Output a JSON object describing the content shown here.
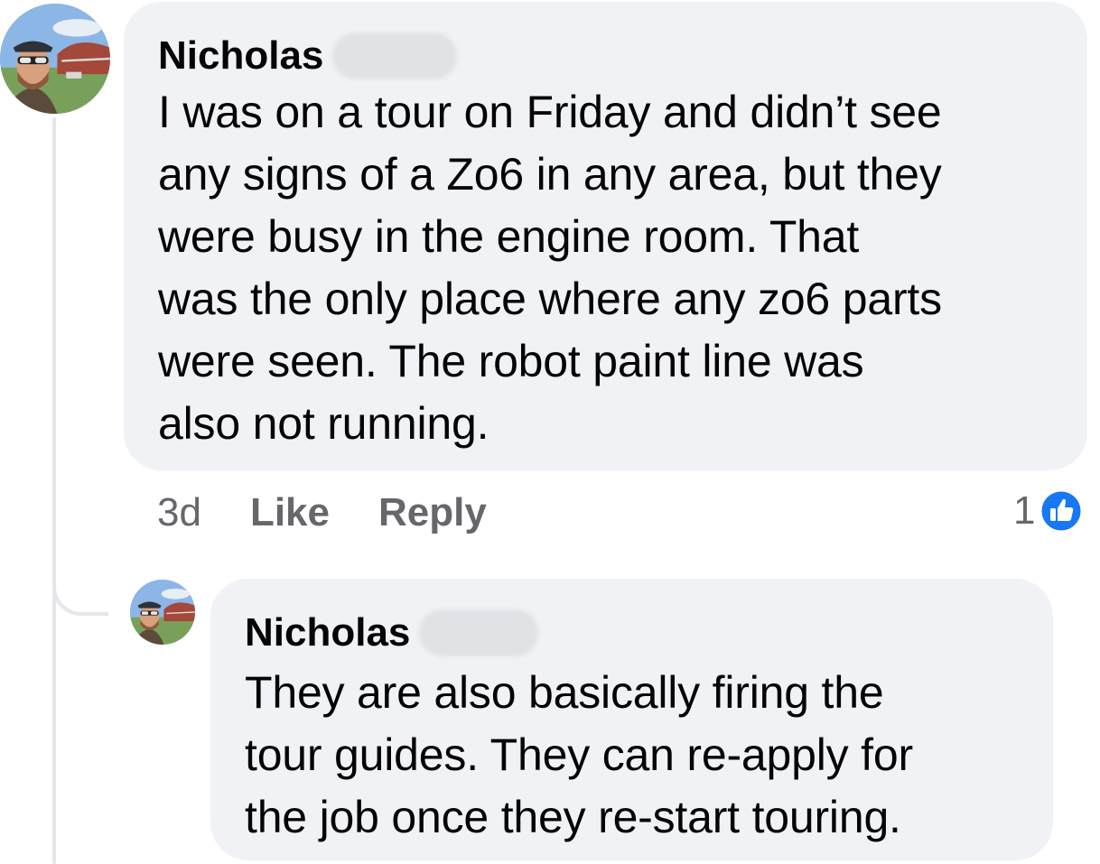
{
  "comment": {
    "author": "Nicholas",
    "text": "I was on a tour on Friday and didn’t see\nany signs of a Zo6 in any area, but they\nwere busy in the engine room. That\nwas the only place where any zo6 parts\nwere seen. The robot paint line was\nalso not running.",
    "time": "3d",
    "like_label": "Like",
    "reply_label": "Reply",
    "reaction_count": "1",
    "reaction_icon": "like-thumb-icon",
    "reaction_color": "#1877f2"
  },
  "reply": {
    "author": "Nicholas",
    "text": "They are also basically firing the\ntour guides. They can re-apply for\nthe job once they re-start touring."
  },
  "colors": {
    "bubble": "#f0f2f5",
    "secondary_text": "#65676b",
    "thread_line": "#e4e6eb"
  }
}
